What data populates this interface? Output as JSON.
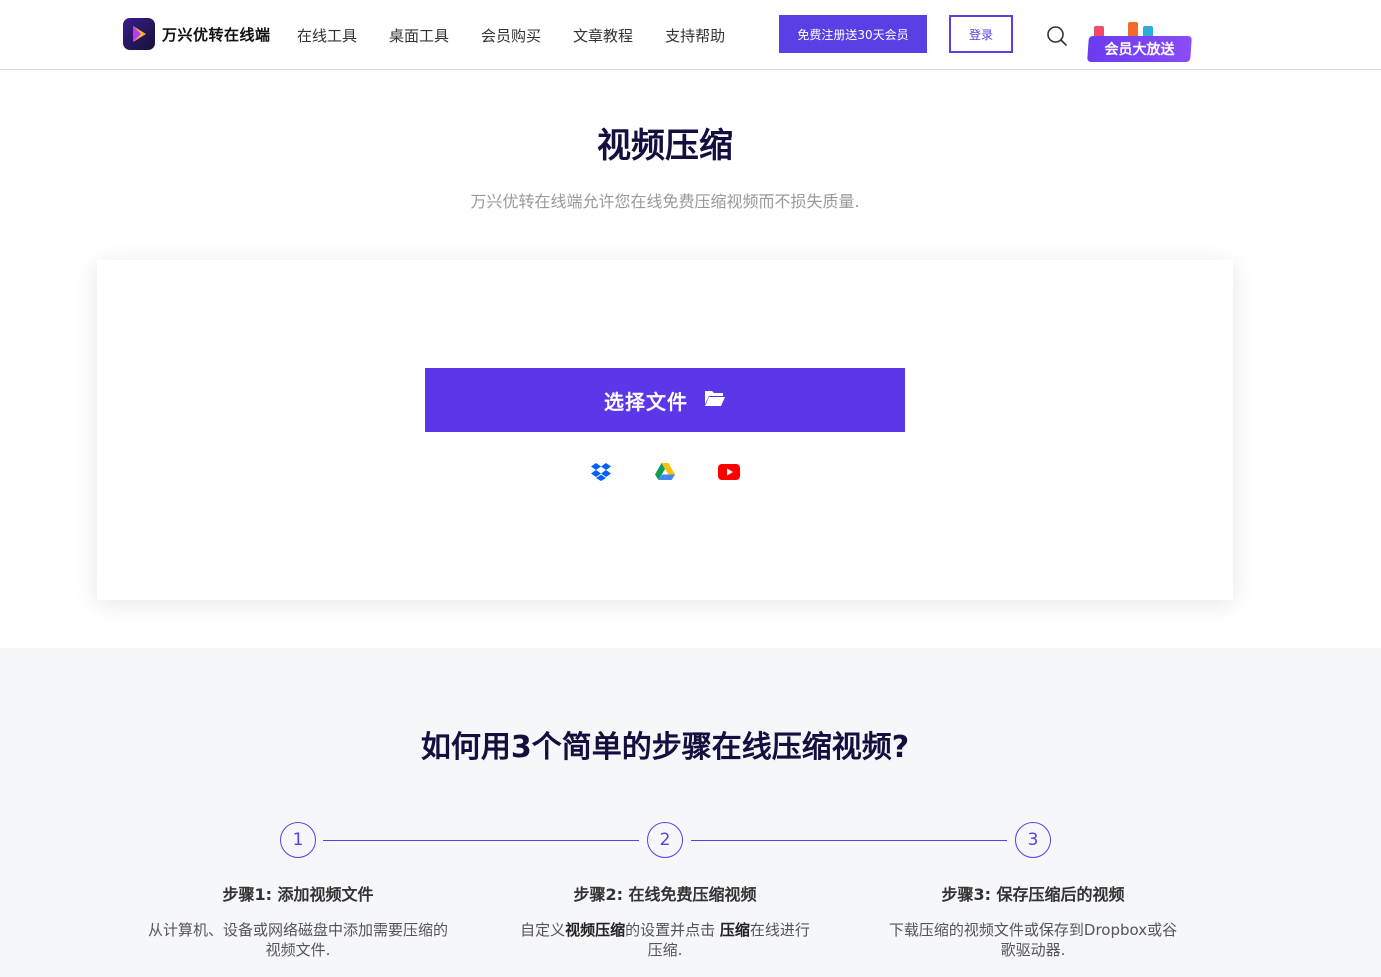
{
  "header": {
    "logo_text": "万兴优转在线端",
    "nav": [
      "在线工具",
      "桌面工具",
      "会员购买",
      "文章教程",
      "支持帮助"
    ],
    "register_label": "免费注册送30天会员",
    "login_label": "登录",
    "promo_label": "会员大放送"
  },
  "hero": {
    "title": "视频压缩",
    "subtitle": "万兴优转在线端允许您在线免费压缩视频而不损失质量."
  },
  "upload": {
    "choose_label": "选择文件",
    "sources": [
      "dropbox-icon",
      "google-drive-icon",
      "youtube-icon"
    ]
  },
  "steps": {
    "title": "如何用3个简单的步骤在线压缩视频?",
    "items": [
      {
        "num": "1",
        "head": "步骤1: 添加视频文件",
        "desc_a": "从计算机、设备或网络磁盘中添加需要压缩的视频文件.",
        "desc_bold1": "",
        "desc_b": "",
        "desc_bold2": "",
        "desc_c": ""
      },
      {
        "num": "2",
        "head": "步骤2: 在线免费压缩视频",
        "desc_a": "自定义",
        "desc_bold1": "视频压缩",
        "desc_b": "的设置并点击 ",
        "desc_bold2": "压缩",
        "desc_c": "在线进行压缩."
      },
      {
        "num": "3",
        "head": "步骤3: 保存压缩后的视频",
        "desc_a": "下载压缩的视频文件或保存到Dropbox或谷歌驱动器.",
        "desc_bold1": "",
        "desc_b": "",
        "desc_bold2": "",
        "desc_c": ""
      }
    ]
  },
  "colors": {
    "accent": "#5a3ee6",
    "title": "#13103f",
    "steps_bg": "#f6f7fa"
  }
}
